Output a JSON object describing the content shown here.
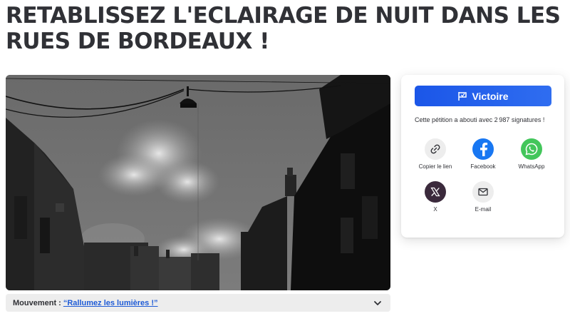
{
  "petition": {
    "title": "RETABLISSEZ L'ECLAIRAGE DE NUIT DANS LES RUES DE BORDEAUX !"
  },
  "movement": {
    "label": "Mouvement :",
    "link_text": "“Rallumez les lumières !”",
    "toggle_icon": "chevron-down-icon"
  },
  "card": {
    "victory_label": "Victoire",
    "victory_icon": "flag-icon",
    "victory_color": "#1b56e8",
    "status_text": "Cette pétition a abouti avec 2 987 signatures !",
    "share": [
      {
        "label": "Copier le lien",
        "icon": "link-icon",
        "color": "#ededed"
      },
      {
        "label": "Facebook",
        "icon": "facebook-icon",
        "color": "#1877f2"
      },
      {
        "label": "WhatsApp",
        "icon": "whatsapp-icon",
        "color": "#43c65b"
      },
      {
        "label": "X",
        "icon": "x-icon",
        "color": "#3b2a3c"
      },
      {
        "label": "E-mail",
        "icon": "mail-icon",
        "color": "#ededed"
      }
    ]
  }
}
